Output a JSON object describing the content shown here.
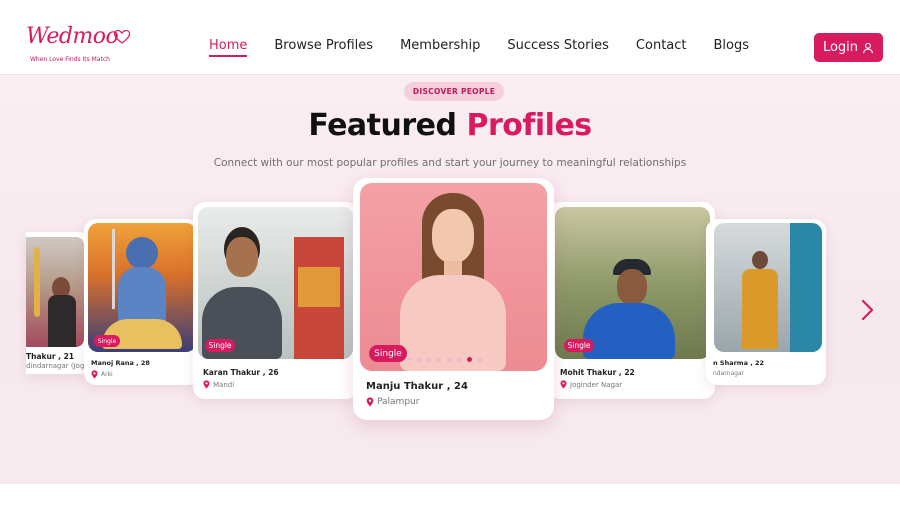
{
  "brand": {
    "name": "Wedmoo",
    "tagline": "When Love Finds Its Match"
  },
  "nav": {
    "items": [
      {
        "label": "Home",
        "active": true
      },
      {
        "label": "Browse Profiles"
      },
      {
        "label": "Membership"
      },
      {
        "label": "Success Stories"
      },
      {
        "label": "Contact"
      },
      {
        "label": "Blogs"
      }
    ],
    "login_label": "Login"
  },
  "hero": {
    "pill": "DISCOVER PEOPLE",
    "title_main": "Featured ",
    "title_accent": "Profiles",
    "subtitle": "Connect with our most popular profiles and start your journey to meaningful relationships"
  },
  "profiles": [
    {
      "name": "Thakur , 21",
      "location": "dindarnagar (Joginder",
      "badge": ""
    },
    {
      "name": "Manoj Rana , 28",
      "location": "Arki",
      "badge": "Single"
    },
    {
      "name": "Karan Thakur , 26",
      "location": "Mandi",
      "badge": "Single"
    },
    {
      "name": "Manju Thakur , 24",
      "location": "Palampur",
      "badge": "Single"
    },
    {
      "name": "Mohit Thakur , 22",
      "location": "Joginder Nagar",
      "badge": "Single"
    },
    {
      "name": "n Sharma , 22",
      "location": "ndarnagar",
      "badge": ""
    }
  ],
  "carousel": {
    "page_count": 8,
    "active_index": 6
  },
  "colors": {
    "accent": "#d81b60",
    "background": "#f7eaef",
    "pill_bg": "#f6cfdc"
  },
  "icons": {
    "next": "chevron-right-icon",
    "location": "map-pin-icon",
    "user": "user-icon"
  }
}
